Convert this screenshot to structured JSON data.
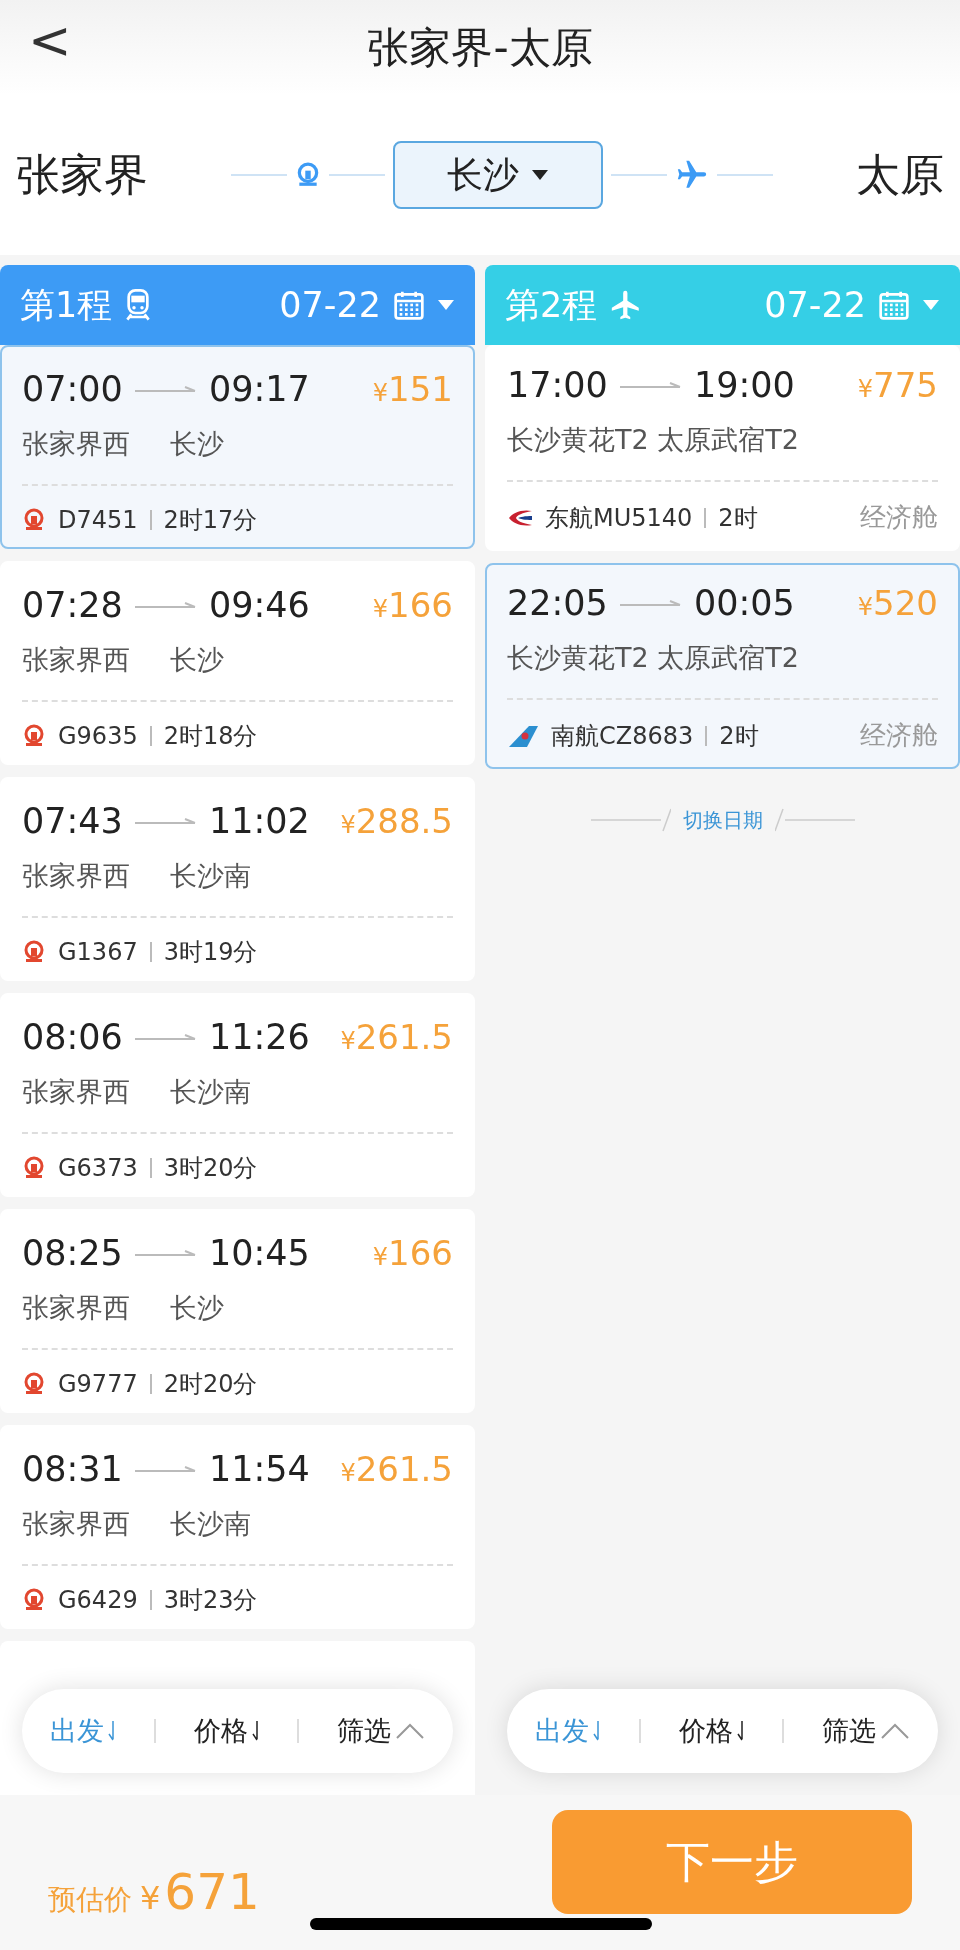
{
  "nav": {
    "back": "<",
    "title": "张家界-太原"
  },
  "route": {
    "from": "张家界",
    "via": "长沙",
    "to": "太原",
    "legs": [
      {
        "kind": "train"
      },
      {
        "kind": "plane"
      }
    ]
  },
  "legs": [
    {
      "label": "第1程",
      "kind": "train",
      "date": "07-22",
      "color": "#3d9bf5",
      "options": [
        {
          "depart": "07:00",
          "arrive": "09:17",
          "currency": "¥",
          "price": "151",
          "from": "张家界西",
          "to": "长沙",
          "code": "D7451",
          "duration": "2时17分",
          "selected": true
        },
        {
          "depart": "07:28",
          "arrive": "09:46",
          "currency": "¥",
          "price": "166",
          "from": "张家界西",
          "to": "长沙",
          "code": "G9635",
          "duration": "2时18分",
          "selected": false
        },
        {
          "depart": "07:43",
          "arrive": "11:02",
          "currency": "¥",
          "price": "288.5",
          "from": "张家界西",
          "to": "长沙南",
          "code": "G1367",
          "duration": "3时19分",
          "selected": false
        },
        {
          "depart": "08:06",
          "arrive": "11:26",
          "currency": "¥",
          "price": "261.5",
          "from": "张家界西",
          "to": "长沙南",
          "code": "G6373",
          "duration": "3时20分",
          "selected": false
        },
        {
          "depart": "08:25",
          "arrive": "10:45",
          "currency": "¥",
          "price": "166",
          "from": "张家界西",
          "to": "长沙",
          "code": "G9777",
          "duration": "2时20分",
          "selected": false
        },
        {
          "depart": "08:31",
          "arrive": "11:54",
          "currency": "¥",
          "price": "261.5",
          "from": "张家界西",
          "to": "长沙南",
          "code": "G6429",
          "duration": "3时23分",
          "selected": false
        }
      ],
      "sort": [
        {
          "label": "出发",
          "selected": true,
          "arrow": true
        },
        {
          "label": "价格",
          "selected": false,
          "arrow": true
        },
        {
          "label": "筛选",
          "selected": false,
          "arrow": false
        }
      ]
    },
    {
      "label": "第2程",
      "kind": "plane",
      "date": "07-22",
      "color": "#35cfe6",
      "options": [
        {
          "depart": "17:00",
          "arrive": "19:00",
          "currency": "¥",
          "price": "775",
          "route": "长沙黄花T2 太原武宿T2",
          "kind": "eastern",
          "code": "东航MU5140",
          "duration": "2时",
          "cabin": "经济舱",
          "selected": false
        },
        {
          "depart": "22:05",
          "arrive": "00:05",
          "currency": "¥",
          "price": "520",
          "route": "长沙黄花T2 太原武宿T2",
          "kind": "southern",
          "code": "南航CZ8683",
          "duration": "2时",
          "cabin": "经济舱",
          "selected": true
        }
      ],
      "switch_date": "切换日期",
      "sort": [
        {
          "label": "出发",
          "selected": true,
          "arrow": true
        },
        {
          "label": "价格",
          "selected": false,
          "arrow": true
        },
        {
          "label": "筛选",
          "selected": false,
          "arrow": false
        }
      ]
    }
  ],
  "footer": {
    "label": "预估价",
    "currency": "¥",
    "total": "671",
    "next": "下一步"
  }
}
